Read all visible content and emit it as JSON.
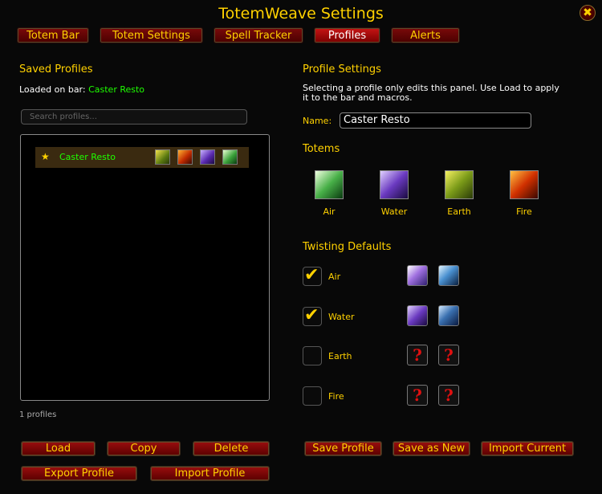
{
  "window": {
    "title": "TotemWeave Settings",
    "close_glyph": "✖"
  },
  "tabs": [
    {
      "label": "Totem Bar",
      "active": false
    },
    {
      "label": "Totem Settings",
      "active": false
    },
    {
      "label": "Spell Tracker",
      "active": false
    },
    {
      "label": "Profiles",
      "active": true
    },
    {
      "label": "Alerts",
      "active": false
    }
  ],
  "left": {
    "header": "Saved Profiles",
    "loaded_prefix": "Loaded on bar:",
    "loaded_name": "Caster Resto",
    "search_placeholder": "Search profiles...",
    "profiles": [
      {
        "name": "Caster Resto",
        "star": "★",
        "icons": [
          "earth-totem-icon",
          "fire-totem-icon",
          "water-totem-icon",
          "air-totem-icon"
        ]
      }
    ],
    "count_text": "1 profiles",
    "buttons": {
      "load": "Load",
      "copy": "Copy",
      "delete": "Delete",
      "export": "Export Profile",
      "import": "Import Profile"
    }
  },
  "right": {
    "header": "Profile Settings",
    "help": "Selecting a profile only edits this panel. Use Load to apply it to the bar and macros.",
    "name_label": "Name:",
    "name_value": "Caster Resto",
    "totems_header": "Totems",
    "totems": [
      {
        "label": "Air",
        "icon": "air-totem-icon"
      },
      {
        "label": "Water",
        "icon": "water-totem-icon"
      },
      {
        "label": "Earth",
        "icon": "earth-totem-icon"
      },
      {
        "label": "Fire",
        "icon": "fire-totem-icon"
      }
    ],
    "twisting_header": "Twisting Defaults",
    "twisting": [
      {
        "label": "Air",
        "checked": true,
        "icons": [
          "windfury-icon",
          "grace-of-air-icon"
        ]
      },
      {
        "label": "Water",
        "checked": true,
        "icons": [
          "mana-spring-icon",
          "poison-cleansing-icon"
        ]
      },
      {
        "label": "Earth",
        "checked": false,
        "icons": [
          "unknown-icon",
          "unknown-icon"
        ]
      },
      {
        "label": "Fire",
        "checked": false,
        "icons": [
          "unknown-icon",
          "unknown-icon"
        ]
      }
    ],
    "question_glyph": "?",
    "check_glyph": "✔",
    "buttons": {
      "save": "Save Profile",
      "save_new": "Save as New",
      "import_current": "Import Current"
    }
  },
  "colors": {
    "gold": "#ffd100",
    "green": "#1eff00",
    "button_red": "#9a0e0e"
  }
}
